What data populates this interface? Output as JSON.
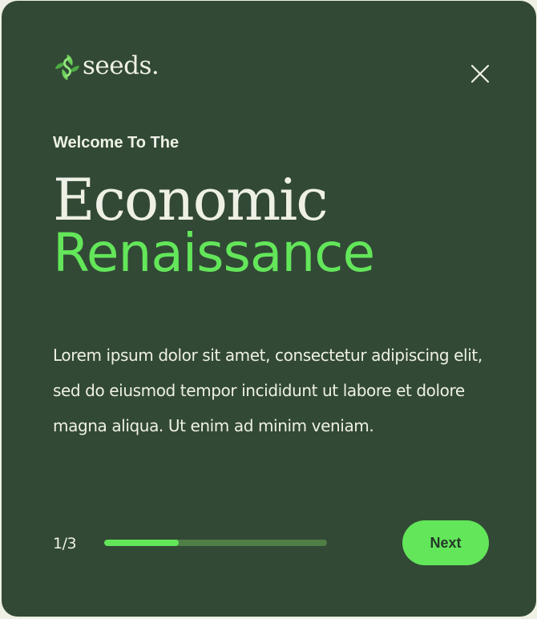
{
  "brand": {
    "logo_text": "seeds.",
    "icon": "leaf-s-logo-icon"
  },
  "dialog": {
    "close_icon": "close-icon",
    "eyebrow": "Welcome To The",
    "headline_line1": "Economic",
    "headline_line2": "Renaissance",
    "body": "Lorem ipsum dolor sit amet, consectetur adipiscing elit, sed do eiusmod tempor incididunt ut labore et dolore magna aliqua. Ut enim ad minim veniam."
  },
  "footer": {
    "step_label": "1/3",
    "progress_fraction": 0.333,
    "next_label": "Next"
  },
  "colors": {
    "card_bg": "#324936",
    "accent": "#63e65a",
    "text_light": "#eef0e6",
    "track": "#4f7e47",
    "button_text": "#25392a"
  }
}
